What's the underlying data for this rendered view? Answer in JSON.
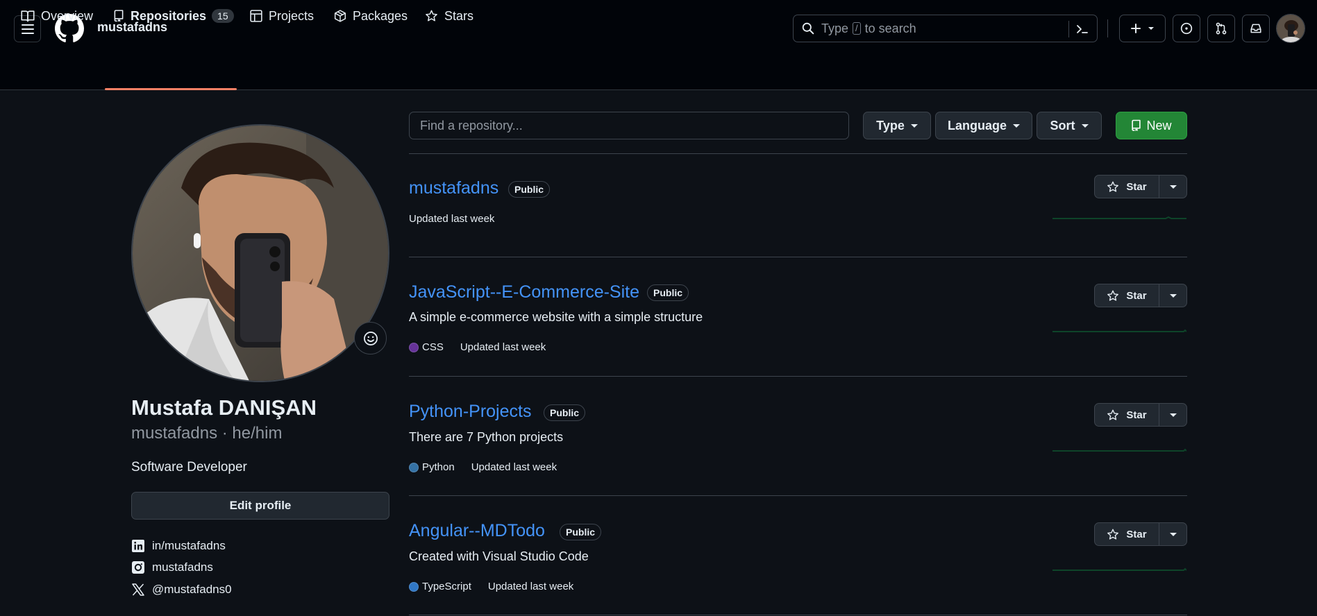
{
  "header": {
    "username": "mustafadns",
    "search": {
      "prefix": "Type",
      "kbd": "/",
      "suffix": "to search"
    }
  },
  "tabs": [
    {
      "label": "Overview"
    },
    {
      "label": "Repositories",
      "count": "15",
      "selected": true
    },
    {
      "label": "Projects"
    },
    {
      "label": "Packages"
    },
    {
      "label": "Stars"
    }
  ],
  "profile": {
    "name": "Mustafa DANIŞAN",
    "handle": "mustafadns · he/him",
    "bio": "Software Developer",
    "edit_label": "Edit profile",
    "socials": [
      {
        "icon": "linkedin-icon",
        "text": "in/mustafadns"
      },
      {
        "icon": "instagram-icon",
        "text": "mustafadns"
      },
      {
        "icon": "x-twitter-icon",
        "text": "@mustafadns0"
      }
    ]
  },
  "toolbar": {
    "find_placeholder": "Find a repository...",
    "type_label": "Type",
    "language_label": "Language",
    "sort_label": "Sort",
    "new_label": "New"
  },
  "repos": [
    {
      "name": "mustafadns",
      "visibility": "Public",
      "description": "",
      "language": "",
      "language_color": "",
      "updated": "Updated last week",
      "star_label": "Star"
    },
    {
      "name": "JavaScript--E-Commerce-Site",
      "visibility": "Public",
      "description": "A simple e-commerce website with a simple structure",
      "language": "CSS",
      "language_color": "#663399",
      "updated": "Updated last week",
      "star_label": "Star"
    },
    {
      "name": "Python-Projects",
      "visibility": "Public",
      "description": "There are 7 Python projects",
      "language": "Python",
      "language_color": "#3572A5",
      "updated": "Updated last week",
      "star_label": "Star"
    },
    {
      "name": "Angular--MDTodo",
      "visibility": "Public",
      "description": "Created with Visual Studio Code",
      "language": "TypeScript",
      "language_color": "#3178c6",
      "updated": "Updated last week",
      "star_label": "Star"
    }
  ],
  "colors": {
    "accent_link": "#4493f8",
    "new_button": "#238636",
    "tab_underline": "#f78166",
    "activity_line": "#0e4429"
  }
}
